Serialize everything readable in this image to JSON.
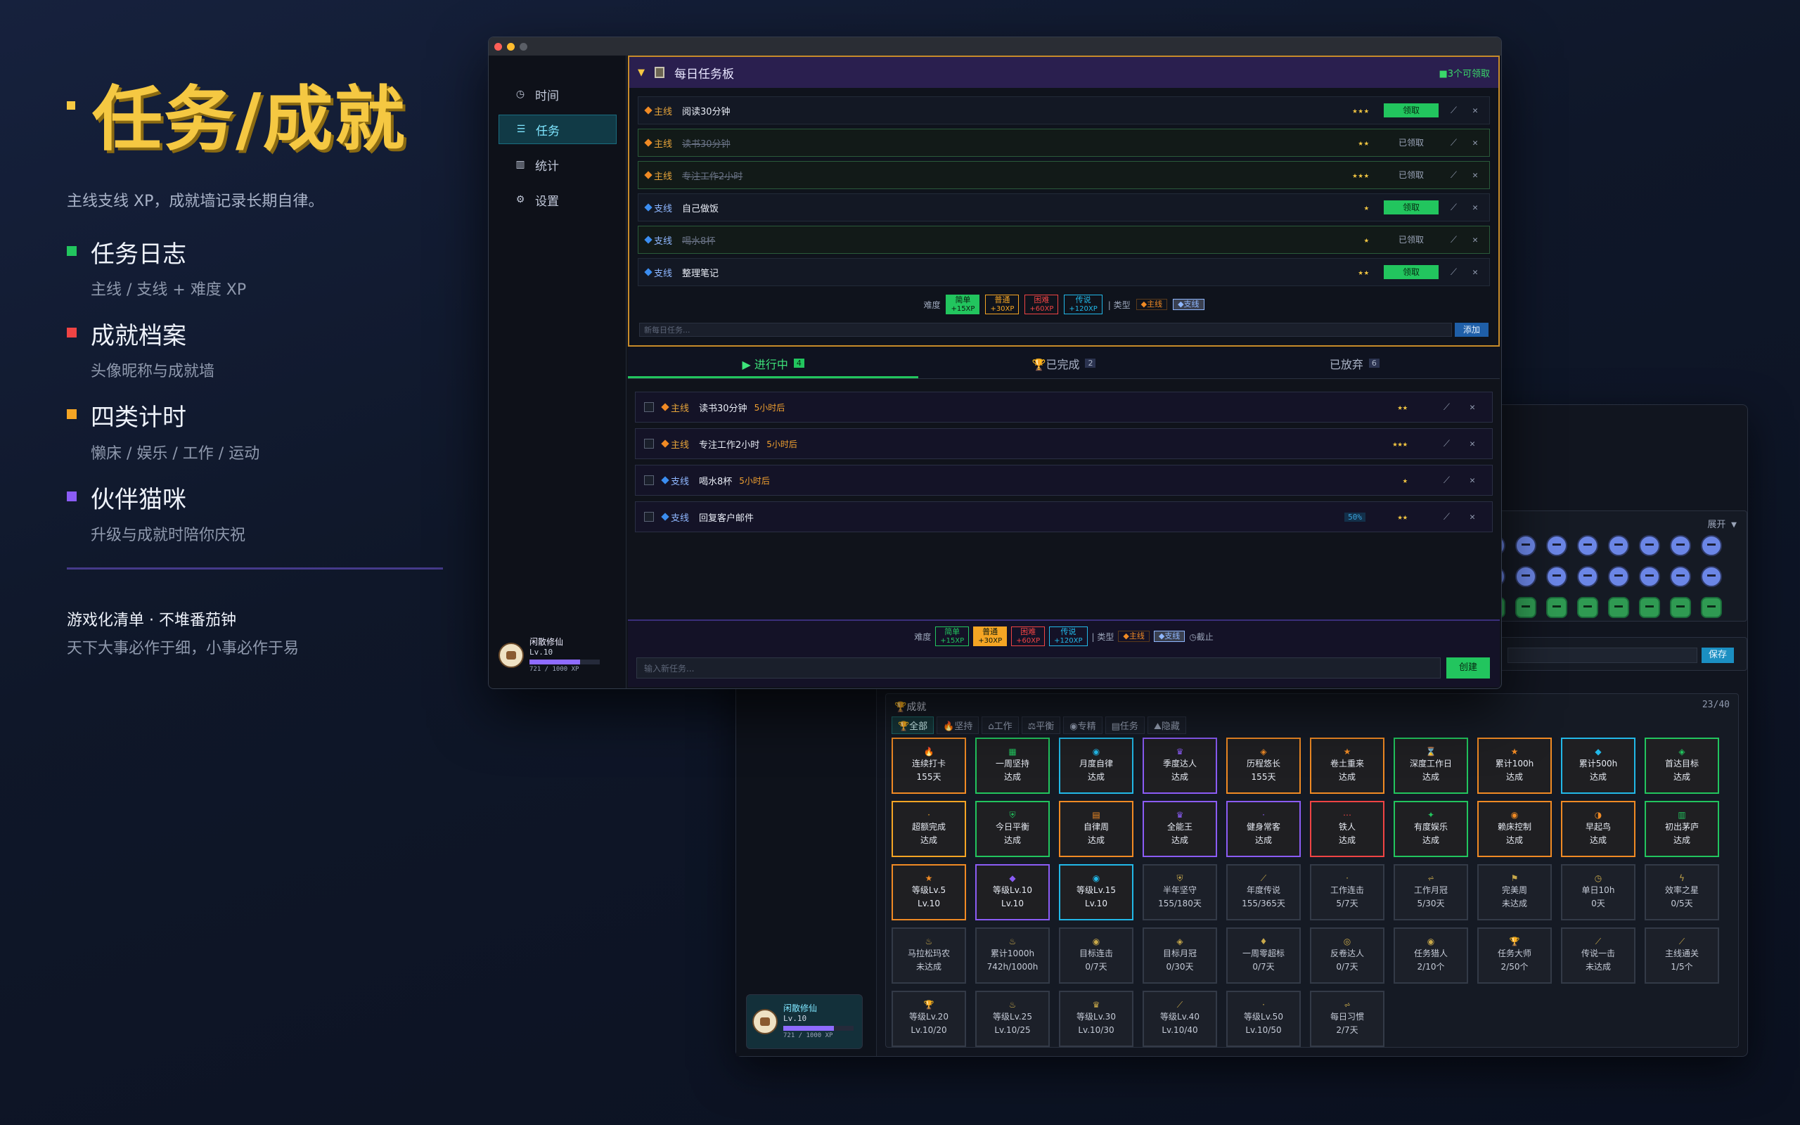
{
  "hero": {
    "title": "任务/成就",
    "subtitle": "主线支线 XP，成就墙记录长期自律。",
    "features": [
      {
        "title": "任务日志",
        "desc": "主线 / 支线 + 难度 XP",
        "color": "#22c55e"
      },
      {
        "title": "成就档案",
        "desc": "头像昵称与成就墙",
        "color": "#ef4444"
      },
      {
        "title": "四类计时",
        "desc": "懒床 / 娱乐 / 工作 / 运动",
        "color": "#f5a524"
      },
      {
        "title": "伙伴猫咪",
        "desc": "升级与成就时陪你庆祝",
        "color": "#8b5cf6"
      }
    ],
    "tagline": "游戏化清单 · 不堆番茄钟",
    "motto": "天下大事必作于细，小事必作于易"
  },
  "sidebar": {
    "items": [
      {
        "label": "时间",
        "icon": "clock-icon",
        "glyph": "◷"
      },
      {
        "label": "任务",
        "icon": "task-icon",
        "glyph": "☰"
      },
      {
        "label": "统计",
        "icon": "chart-icon",
        "glyph": "▥"
      },
      {
        "label": "设置",
        "icon": "gear-icon",
        "glyph": "⚙"
      }
    ]
  },
  "profile": {
    "name": "闲散修仙",
    "level": "Lv.10",
    "xp_text": "721 / 1000 XP",
    "xp_progress": 0.721
  },
  "board": {
    "title": "每日任务板",
    "available": "■3个可领取",
    "tasks": [
      {
        "type": "主线",
        "name": "阅读30分钟",
        "stars": "★★★",
        "claim": "领取",
        "claimable": true,
        "done": false
      },
      {
        "type": "主线",
        "name": "读书30分钟",
        "stars": "★★",
        "claim": "已领取",
        "claimable": false,
        "done": true
      },
      {
        "type": "主线",
        "name": "专注工作2小时",
        "stars": "★★★",
        "claim": "已领取",
        "claimable": false,
        "done": true
      },
      {
        "type": "支线",
        "name": "自己做饭",
        "stars": "★",
        "claim": "领取",
        "claimable": true,
        "done": false
      },
      {
        "type": "支线",
        "name": "喝水8杯",
        "stars": "★",
        "claim": "已领取",
        "claimable": false,
        "done": true
      },
      {
        "type": "支线",
        "name": "整理笔记",
        "stars": "★★",
        "claim": "领取",
        "claimable": true,
        "done": false
      }
    ],
    "diff_label": "难度",
    "type_label": "| 类型",
    "difficulties": [
      {
        "name": "简单",
        "xp": "+15XP",
        "color": "#22c55e"
      },
      {
        "name": "普通",
        "xp": "+30XP",
        "color": "#f5a524"
      },
      {
        "name": "困难",
        "xp": "+60XP",
        "color": "#ef4444"
      },
      {
        "name": "传说",
        "xp": "+120XP",
        "color": "#22b8e8"
      }
    ],
    "types": [
      "◆主线",
      "◆支线"
    ],
    "new_placeholder": "新每日任务...",
    "add_label": "添加"
  },
  "tabs": [
    {
      "label": "▶ 进行中",
      "count": "4",
      "icon": "scroll-icon"
    },
    {
      "label": "🏆已完成",
      "count": "2",
      "icon": "trophy-icon"
    },
    {
      "label": "已放弃",
      "count": "6",
      "icon": "trash-icon"
    }
  ],
  "progress_tasks": [
    {
      "type": "主线",
      "name": "读书30分钟",
      "due": "5小时后",
      "stars": "★★",
      "repeat": ""
    },
    {
      "type": "主线",
      "name": "专注工作2小时",
      "due": "5小时后",
      "stars": "★★★",
      "repeat": ""
    },
    {
      "type": "支线",
      "name": "喝水8杯",
      "due": "5小时后",
      "stars": "★",
      "repeat": ""
    },
    {
      "type": "支线",
      "name": "回复客户邮件",
      "due": "",
      "stars": "★★",
      "repeat": "50%"
    }
  ],
  "composer": {
    "diff_label": "难度",
    "type_label": "| 类型",
    "deadline": "◷截止",
    "placeholder": "输入新任务...",
    "create_label": "创建"
  },
  "back": {
    "expand": "展开 ▼",
    "save": "保存",
    "ach_title": "🏆成就",
    "ach_count": "23/40",
    "ach_tabs": [
      "🏆全部",
      "🔥坚持",
      "⌂工作",
      "⚖平衡",
      "◉专精",
      "▤任务",
      "⛰隐藏"
    ],
    "achievements": [
      {
        "name": "连续打卡",
        "val": "155天",
        "color": "#f08a24",
        "glyph": "🔥"
      },
      {
        "name": "一周坚持",
        "val": "达成",
        "color": "#22c55e",
        "glyph": "▦"
      },
      {
        "name": "月度自律",
        "val": "达成",
        "color": "#22b8e8",
        "glyph": "◉"
      },
      {
        "name": "季度达人",
        "val": "达成",
        "color": "#8b5cf6",
        "glyph": "♛"
      },
      {
        "name": "历程悠长",
        "val": "155天",
        "color": "#f08a24",
        "glyph": "◈"
      },
      {
        "name": "卷土重来",
        "val": "达成",
        "color": "#f08a24",
        "glyph": "★"
      },
      {
        "name": "深度工作日",
        "val": "达成",
        "color": "#22c55e",
        "glyph": "⌛"
      },
      {
        "name": "累计100h",
        "val": "达成",
        "color": "#f08a24",
        "glyph": "★"
      },
      {
        "name": "累计500h",
        "val": "达成",
        "color": "#22b8e8",
        "glyph": "◆"
      },
      {
        "name": "首达目标",
        "val": "达成",
        "color": "#22c55e",
        "glyph": "◈"
      },
      {
        "name": "超额完成",
        "val": "达成",
        "color": "#f5a524",
        "glyph": "·"
      },
      {
        "name": "今日平衡",
        "val": "达成",
        "color": "#22c55e",
        "glyph": "⛨"
      },
      {
        "name": "自律周",
        "val": "达成",
        "color": "#f08a24",
        "glyph": "▤"
      },
      {
        "name": "全能王",
        "val": "达成",
        "color": "#8b5cf6",
        "glyph": "♛"
      },
      {
        "name": "健身常客",
        "val": "达成",
        "color": "#8b5cf6",
        "glyph": "·"
      },
      {
        "name": "铁人",
        "val": "达成",
        "color": "#ef4444",
        "glyph": "⋯"
      },
      {
        "name": "有度娱乐",
        "val": "达成",
        "color": "#22c55e",
        "glyph": "✦"
      },
      {
        "name": "赖床控制",
        "val": "达成",
        "color": "#f08a24",
        "glyph": "◉"
      },
      {
        "name": "早起鸟",
        "val": "达成",
        "color": "#f08a24",
        "glyph": "◑"
      },
      {
        "name": "初出茅庐",
        "val": "达成",
        "color": "#22c55e",
        "glyph": "▥"
      },
      {
        "name": "等级Lv.5",
        "val": "Lv.10",
        "color": "#f08a24",
        "glyph": "★"
      },
      {
        "name": "等级Lv.10",
        "val": "Lv.10",
        "color": "#8b5cf6",
        "glyph": "◆"
      },
      {
        "name": "等级Lv.15",
        "val": "Lv.10",
        "color": "#22b8e8",
        "glyph": "◉"
      },
      {
        "name": "半年坚守",
        "val": "155/180天",
        "color": "",
        "glyph": "⛨"
      },
      {
        "name": "年度传说",
        "val": "155/365天",
        "color": "",
        "glyph": "⟋"
      },
      {
        "name": "工作连击",
        "val": "5/7天",
        "color": "",
        "glyph": "·"
      },
      {
        "name": "工作月冠",
        "val": "5/30天",
        "color": "",
        "glyph": "⩫"
      },
      {
        "name": "完美周",
        "val": "未达成",
        "color": "",
        "glyph": "⚑"
      },
      {
        "name": "单日10h",
        "val": "0天",
        "color": "",
        "glyph": "◷"
      },
      {
        "name": "效率之星",
        "val": "0/5天",
        "color": "",
        "glyph": "ϟ"
      },
      {
        "name": "马拉松玛农",
        "val": "未达成",
        "color": "",
        "glyph": "♨"
      },
      {
        "name": "累计1000h",
        "val": "742h/1000h",
        "color": "",
        "glyph": "♨"
      },
      {
        "name": "目标连击",
        "val": "0/7天",
        "color": "",
        "glyph": "◉"
      },
      {
        "name": "目标月冠",
        "val": "0/30天",
        "color": "",
        "glyph": "◈"
      },
      {
        "name": "一周零超标",
        "val": "0/7天",
        "color": "",
        "glyph": "♦"
      },
      {
        "name": "反卷达人",
        "val": "0/7天",
        "color": "",
        "glyph": "◎"
      },
      {
        "name": "任务猎人",
        "val": "2/10个",
        "color": "",
        "glyph": "◉"
      },
      {
        "name": "任务大师",
        "val": "2/50个",
        "color": "",
        "glyph": "🏆"
      },
      {
        "name": "传说一击",
        "val": "未达成",
        "color": "",
        "glyph": "⟋"
      },
      {
        "name": "主线通关",
        "val": "1/5个",
        "color": "",
        "glyph": "⟋"
      },
      {
        "name": "等级Lv.20",
        "val": "Lv.10/20",
        "color": "",
        "glyph": "🏆"
      },
      {
        "name": "等级Lv.25",
        "val": "Lv.10/25",
        "color": "",
        "glyph": "♨"
      },
      {
        "name": "等级Lv.30",
        "val": "Lv.10/30",
        "color": "",
        "glyph": "♛"
      },
      {
        "name": "等级Lv.40",
        "val": "Lv.10/40",
        "color": "",
        "glyph": "⟋"
      },
      {
        "name": "等级Lv.50",
        "val": "Lv.10/50",
        "color": "",
        "glyph": "·"
      },
      {
        "name": "每日习惯",
        "val": "2/7天",
        "color": "",
        "glyph": "⩫"
      }
    ]
  }
}
